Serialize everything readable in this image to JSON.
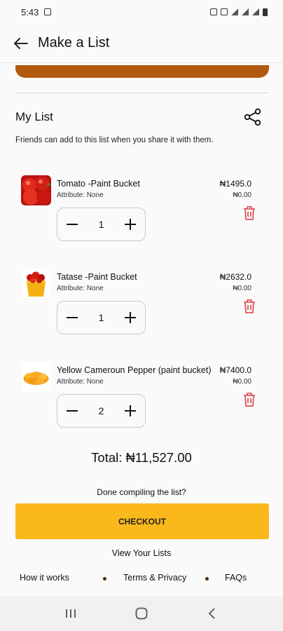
{
  "status_bar": {
    "time": "5:43"
  },
  "header": {
    "title": "Make a List"
  },
  "list": {
    "title": "My List",
    "subtitle": "Friends can add to this list when you share it with them."
  },
  "items": [
    {
      "name": "Tomato -Paint Bucket",
      "attribute": "Attribute: None",
      "price": "₦1495.0",
      "extra_price": "₦0.00",
      "quantity": "1"
    },
    {
      "name": "Tatase -Paint Bucket",
      "attribute": "Attribute: None",
      "price": "₦2632.0",
      "extra_price": "₦0.00",
      "quantity": "1"
    },
    {
      "name": "Yellow Cameroun Pepper (paint bucket)",
      "attribute": "Attribute: None",
      "price": "₦7400.0",
      "extra_price": "₦0.00",
      "quantity": "2"
    }
  ],
  "total": "Total: ₦11,527.00",
  "done_prompt": "Done compiling the list?",
  "checkout_label": "CHECKOUT",
  "view_lists_label": "View Your Lists",
  "footer": {
    "how_it_works": "How it works",
    "terms": "Terms & Privacy",
    "faqs": "FAQs"
  },
  "icons": {
    "back": "arrow-left-icon",
    "share": "share-icon",
    "delete": "trash-icon",
    "nav_recent": "recent-apps-icon",
    "nav_home": "home-icon",
    "nav_back": "back-chevron-icon"
  },
  "colors": {
    "accent": "#fbb81b",
    "strip": "#b25a0f",
    "delete": "#e0525a",
    "background": "#fafafa"
  }
}
